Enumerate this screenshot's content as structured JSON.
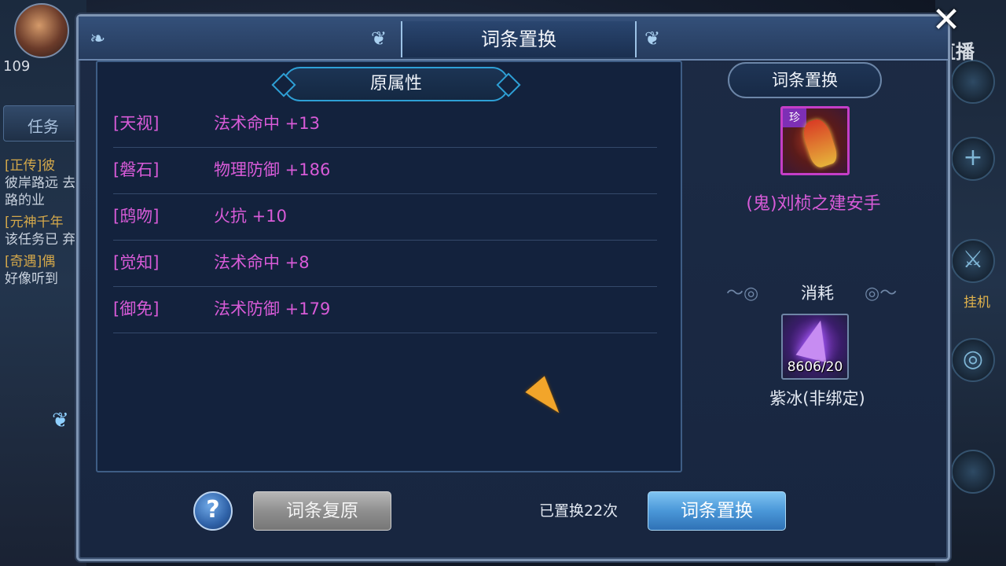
{
  "hud": {
    "level": "109",
    "task_tab": "任务",
    "tasks": [
      {
        "head": "[正传]彼",
        "body": "彼岸路远 去路的业"
      },
      {
        "head": "[元神千年",
        "body": "该任务已 弃"
      },
      {
        "head": "[奇遇]偶",
        "body": "好像听到"
      }
    ],
    "hangup_label": "挂机",
    "stream_logo": "CC直播",
    "close_symbol": "✕"
  },
  "dialog": {
    "title": "词条置换",
    "original_section_label": "原属性",
    "properties": [
      {
        "name": "[天视]",
        "value": "法术命中 +13"
      },
      {
        "name": "[磐石]",
        "value": "物理防御 +186"
      },
      {
        "name": "[鸱吻]",
        "value": "火抗 +10"
      },
      {
        "name": "[觉知]",
        "value": "法术命中 +8"
      },
      {
        "name": "[御免]",
        "value": "法术防御 +179"
      }
    ],
    "replace_section_label": "词条置换",
    "item": {
      "rarity_badge": "珍",
      "name": "(鬼)刘桢之建安手"
    },
    "consume_label": "消耗",
    "material": {
      "count": "8606/20",
      "name": "紫冰(非绑定)"
    },
    "buttons": {
      "help": "?",
      "restore": "词条复原",
      "replace": "词条置换"
    },
    "replace_count_text": "已置换22次"
  },
  "colors": {
    "property_text": "#d85bd8",
    "accent_blue": "#2ea0d6",
    "button_blue": "#4a97d8",
    "button_gray": "#8f8f8f"
  }
}
